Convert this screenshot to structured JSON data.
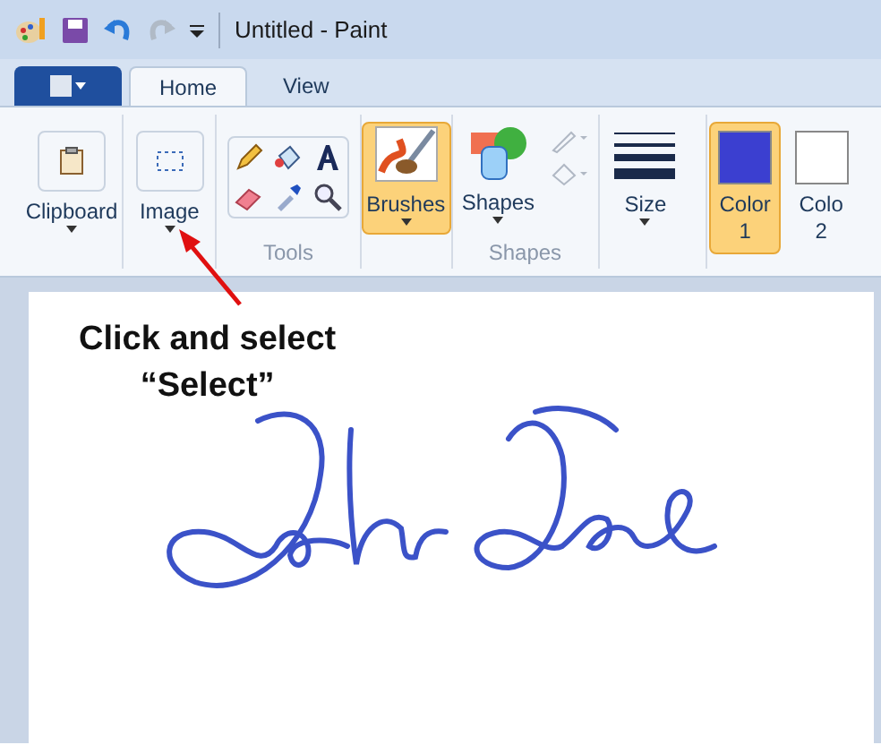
{
  "window": {
    "title": "Untitled - Paint"
  },
  "tabs": [
    {
      "label": "Home",
      "selected": true
    },
    {
      "label": "View",
      "selected": false
    }
  ],
  "ribbon": [
    {
      "kind": "clipboard",
      "label": "Clipboard",
      "selected": false
    },
    {
      "kind": "select",
      "label": "Image",
      "selected": false
    },
    {
      "kind": "tools",
      "group_label": "Tools"
    },
    {
      "kind": "brush",
      "label": "Brushes",
      "selected": true
    },
    {
      "kind": "shapes",
      "label": "Shapes",
      "group_label": "Shapes"
    },
    {
      "kind": "size",
      "label": "Size",
      "selected": false
    },
    {
      "kind": "color",
      "label": "Color",
      "sub": "1",
      "color": "#3b3fd0",
      "selected": true
    },
    {
      "kind": "color",
      "label": "Colo",
      "sub": "2",
      "color": "#ffffff",
      "selected": false
    }
  ],
  "annotation": {
    "lines": [
      "Click and select",
      "“Select”"
    ]
  }
}
